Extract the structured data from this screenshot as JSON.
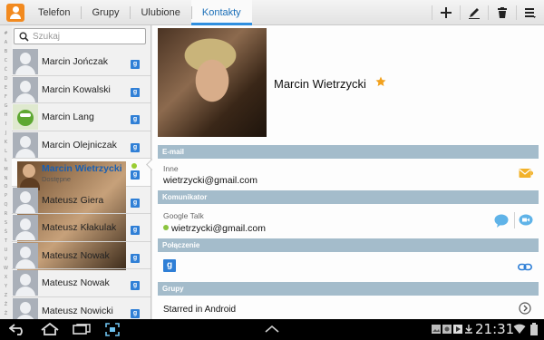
{
  "topbar": {
    "tabs": [
      {
        "label": "Telefon"
      },
      {
        "label": "Grupy"
      },
      {
        "label": "Ulubione"
      },
      {
        "label": "Kontakty",
        "active": true
      }
    ],
    "actions": [
      "add-icon",
      "edit-icon",
      "delete-icon",
      "menu-icon"
    ]
  },
  "sidebar": {
    "search_placeholder": "Szukaj",
    "index_letters": [
      "#",
      "A",
      "B",
      "C",
      "Ć",
      "D",
      "E",
      "F",
      "G",
      "H",
      "I",
      "J",
      "K",
      "L",
      "Ł",
      "M",
      "N",
      "O",
      "P",
      "Q",
      "R",
      "S",
      "Ś",
      "T",
      "U",
      "V",
      "W",
      "X",
      "Y",
      "Z",
      "Ź",
      "Ż"
    ],
    "contacts": [
      {
        "name": "Marcin Jończak",
        "avatar": "placeholder"
      },
      {
        "name": "Marcin Kowalski",
        "avatar": "placeholder"
      },
      {
        "name": "Marcin Lang",
        "avatar": "frog"
      },
      {
        "name": "Marcin Olejniczak",
        "avatar": "placeholder"
      },
      {
        "name": "Marcin Wietrzycki",
        "status": "Dostępne",
        "avatar": "photo",
        "selected": true
      },
      {
        "name": "Mateusz Giera",
        "avatar": "placeholder"
      },
      {
        "name": "Mateusz Kłakulak",
        "avatar": "placeholder"
      },
      {
        "name": "Mateusz Nowak",
        "avatar": "placeholder"
      },
      {
        "name": "Mateusz Nowak",
        "avatar": "placeholder"
      },
      {
        "name": "Mateusz Nowicki",
        "avatar": "placeholder"
      }
    ]
  },
  "detail": {
    "name": "Marcin Wietrzycki",
    "favorite": true,
    "email_section": "E-mail",
    "email_type": "Inne",
    "email": "wietrzycki@gmail.com",
    "im_section": "Komunikator",
    "im_type": "Google Talk",
    "im_address": "wietrzycki@gmail.com",
    "connection_section": "Połączenie",
    "groups_section": "Grupy",
    "group_name": "Starred in Android"
  },
  "statusbar": {
    "time": "21:31"
  },
  "colors": {
    "accent": "#2f8fe0",
    "section_header": "#a4bccb",
    "online": "#8bc43f",
    "favorite_star": "#f2a11d"
  }
}
